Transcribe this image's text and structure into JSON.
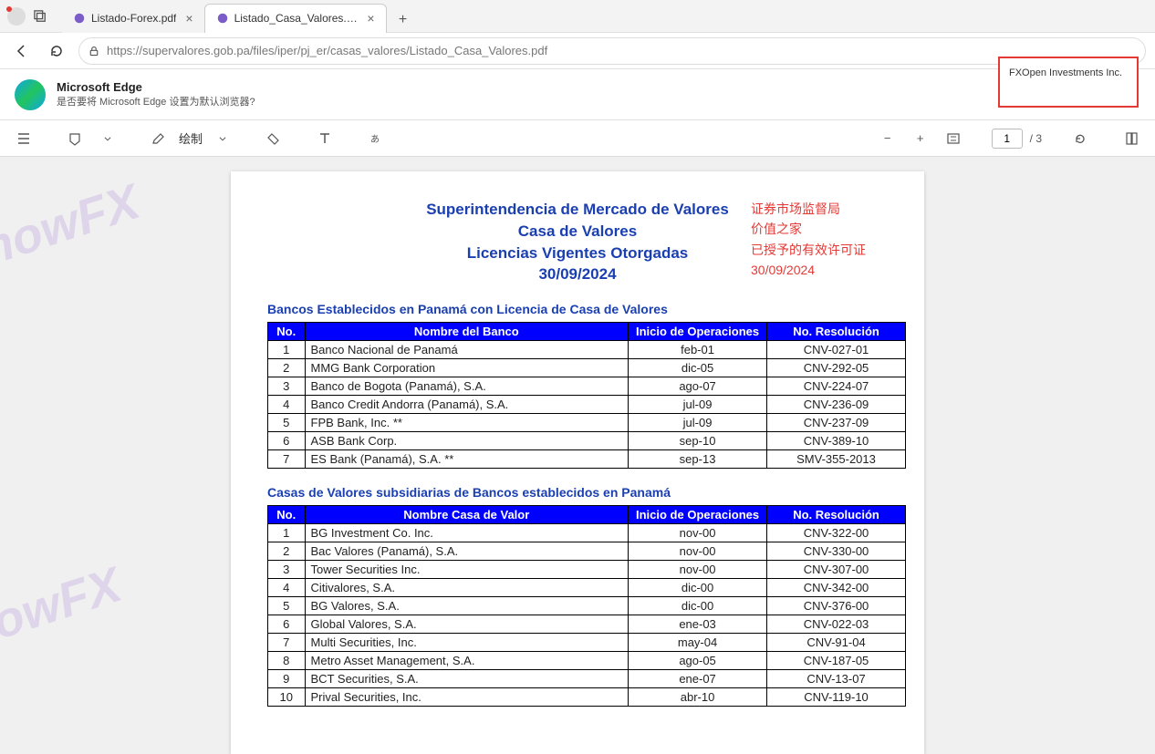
{
  "titlebar": {
    "tabs": [
      {
        "title": "Listado-Forex.pdf",
        "active": false
      },
      {
        "title": "Listado_Casa_Valores.pdf",
        "active": true
      }
    ]
  },
  "addressbar": {
    "url": "https://supervalores.gob.pa/files/iper/pj_er/casas_valores/Listado_Casa_Valores.pdf"
  },
  "edge_prompt": {
    "title": "Microsoft Edge",
    "subtitle": "是否要将 Microsoft Edge 设置为默认浏览器?"
  },
  "highlight": {
    "text": "FXOpen Investments Inc."
  },
  "pdf_toolbar": {
    "draw_label": "绘制",
    "page_current": "1",
    "page_total": "/ 3"
  },
  "document": {
    "title_line1": "Superintendencia de Mercado de Valores",
    "title_line2": "Casa de Valores",
    "title_line3": "Licencias  Vigentes Otorgadas",
    "title_line4": "30/09/2024",
    "cn_line1": "证券市场监督局",
    "cn_line2": "价值之家",
    "cn_line3": "已授予的有效许可证",
    "cn_line4": "30/09/2024",
    "section1_title": "Bancos Establecidos en Panamá con Licencia de Casa de Valores",
    "table1_headers": {
      "no": "No.",
      "name": "Nombre del Banco",
      "inicio": "Inicio de Operaciones",
      "res": "No. Resolución"
    },
    "table1_rows": [
      {
        "no": "1",
        "name": "Banco Nacional de Panamá",
        "inicio": "feb-01",
        "res": "CNV-027-01"
      },
      {
        "no": "2",
        "name": "MMG Bank Corporation",
        "inicio": "dic-05",
        "res": "CNV-292-05"
      },
      {
        "no": "3",
        "name": "Banco de Bogota (Panamá), S.A.",
        "inicio": "ago-07",
        "res": "CNV-224-07"
      },
      {
        "no": "4",
        "name": "Banco Credit Andorra (Panamá), S.A.",
        "inicio": "jul-09",
        "res": "CNV-236-09"
      },
      {
        "no": "5",
        "name": "FPB Bank, Inc. **",
        "inicio": "jul-09",
        "res": "CNV-237-09"
      },
      {
        "no": "6",
        "name": "ASB Bank Corp.",
        "inicio": "sep-10",
        "res": "CNV-389-10"
      },
      {
        "no": "7",
        "name": "ES Bank (Panamá), S.A. **",
        "inicio": "sep-13",
        "res": "SMV-355-2013"
      }
    ],
    "section2_title": "Casas de Valores  subsidiarias  de Bancos establecidos en Panamá",
    "table2_headers": {
      "no": "No.",
      "name": "Nombre Casa de Valor",
      "inicio": "Inicio de Operaciones",
      "res": "No. Resolución"
    },
    "table2_rows": [
      {
        "no": "1",
        "name": "BG Investment Co. Inc.",
        "inicio": "nov-00",
        "res": "CNV-322-00"
      },
      {
        "no": "2",
        "name": "Bac Valores (Panamá), S.A.",
        "inicio": "nov-00",
        "res": "CNV-330-00"
      },
      {
        "no": "3",
        "name": "Tower Securities Inc.",
        "inicio": "nov-00",
        "res": "CNV-307-00"
      },
      {
        "no": "4",
        "name": "Citivalores, S.A.",
        "inicio": "dic-00",
        "res": "CNV-342-00"
      },
      {
        "no": "5",
        "name": "BG Valores, S.A.",
        "inicio": "dic-00",
        "res": "CNV-376-00"
      },
      {
        "no": "6",
        "name": "Global Valores, S.A.",
        "inicio": "ene-03",
        "res": "CNV-022-03"
      },
      {
        "no": "7",
        "name": "Multi Securities, Inc.",
        "inicio": "may-04",
        "res": "CNV-91-04"
      },
      {
        "no": "8",
        "name": "Metro Asset Management, S.A.",
        "inicio": "ago-05",
        "res": "CNV-187-05"
      },
      {
        "no": "9",
        "name": "BCT Securities, S.A.",
        "inicio": "ene-07",
        "res": "CNV-13-07"
      },
      {
        "no": "10",
        "name": "Prival Securities, Inc.",
        "inicio": "abr-10",
        "res": "CNV-119-10"
      }
    ],
    "watermark": "KnowFX"
  }
}
